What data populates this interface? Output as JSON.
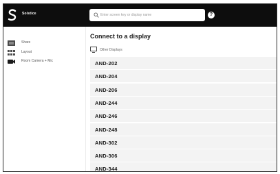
{
  "app": {
    "brand": "Solstice"
  },
  "search": {
    "placeholder": "Enter screen key or display name"
  },
  "help": {
    "label": "?"
  },
  "sidebar": {
    "items": [
      {
        "label": "Share",
        "icon": "share-screen-icon"
      },
      {
        "label": "Layout",
        "icon": "layout-grid-icon"
      },
      {
        "label": "Room Camera + Mic",
        "icon": "camera-icon"
      }
    ]
  },
  "main": {
    "title": "Connect to a display",
    "section_label": "Other Displays",
    "displays": [
      "AND-202",
      "AND-204",
      "AND-206",
      "AND-244",
      "AND-246",
      "AND-248",
      "AND-302",
      "AND-306",
      "AND-344"
    ]
  },
  "colors": {
    "topbar": "#0d0d0d",
    "row": "#f3f3f3",
    "accent": "#ffffff"
  }
}
